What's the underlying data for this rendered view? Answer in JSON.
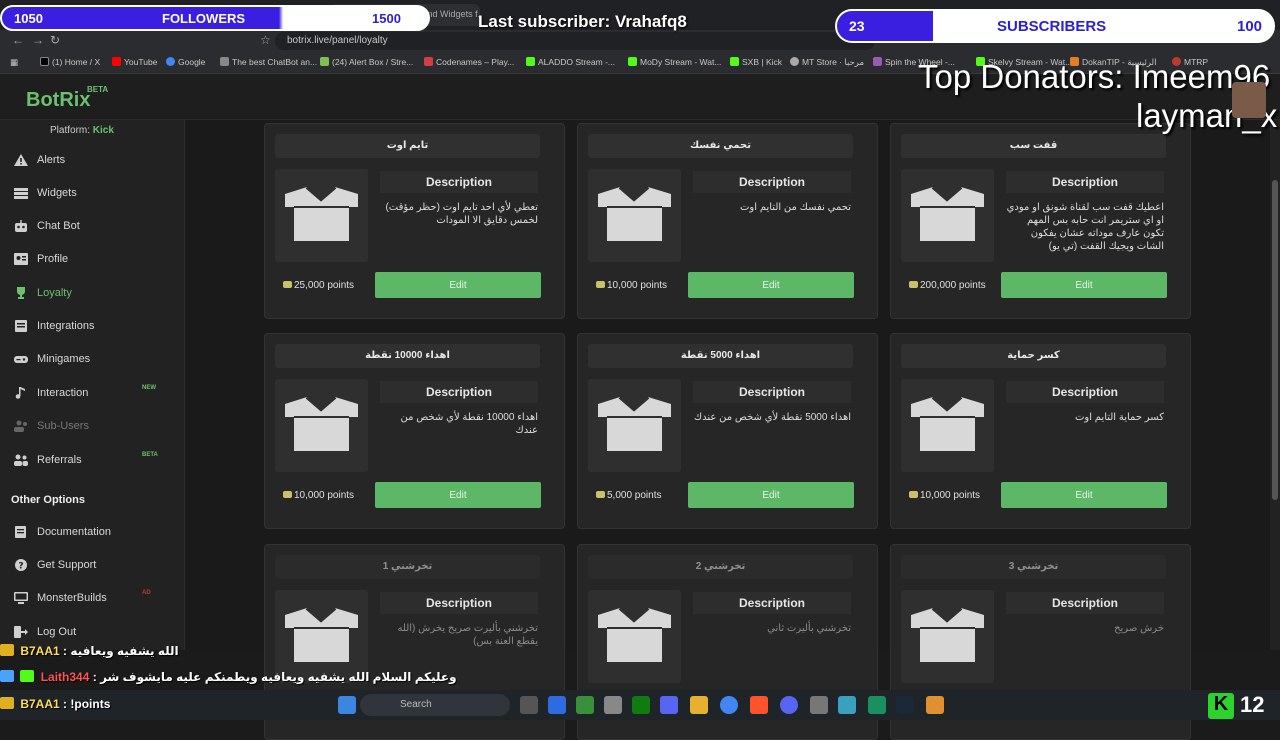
{
  "browser": {
    "active_tab": "The best ChatBot and Widgets f...",
    "url": "botrix.live/panel/loyalty",
    "bookmarks": [
      "(1) Home / X",
      "YouTube",
      "Google",
      "The best ChatBot an...",
      "(24) Alert Box / Stre...",
      "Codenames – Play...",
      "ALADDO Stream -...",
      "MoDy Stream - Wat...",
      "SXB | Kick",
      "MT Store · مرحبا",
      "Spin the Wheel -...",
      "Skelvy Stream - Wat...",
      "DokanTIP - الرئيسية",
      "MTRP"
    ]
  },
  "app": {
    "logo": "BotRix",
    "logo_badge": "BETA",
    "platform_label": "Platform:",
    "platform_value": "Kick"
  },
  "sidebar": {
    "items": [
      {
        "label": "Alerts",
        "icon": "warning-icon"
      },
      {
        "label": "Widgets",
        "icon": "widgets-icon"
      },
      {
        "label": "Chat Bot",
        "icon": "robot-icon"
      },
      {
        "label": "Profile",
        "icon": "profile-icon"
      },
      {
        "label": "Loyalty",
        "icon": "trophy-icon",
        "active": true
      },
      {
        "label": "Integrations",
        "icon": "integrations-icon"
      },
      {
        "label": "Minigames",
        "icon": "gamepad-icon"
      },
      {
        "label": "Interaction",
        "icon": "music-icon",
        "badge": "NEW"
      },
      {
        "label": "Sub-Users",
        "icon": "users-icon",
        "disabled": true
      },
      {
        "label": "Referrals",
        "icon": "referrals-icon",
        "badge": "BETA"
      }
    ],
    "other_options_title": "Other Options",
    "other_items": [
      {
        "label": "Documentation",
        "icon": "book-icon"
      },
      {
        "label": "Get Support",
        "icon": "help-icon"
      },
      {
        "label": "MonsterBuilds",
        "icon": "monitor-icon",
        "badge": "AD"
      },
      {
        "label": "Log Out",
        "icon": "logout-icon"
      }
    ]
  },
  "rewards": [
    {
      "title": "تايم اوت",
      "desc_header": "Description",
      "description": "تعطي لأي احد تايم اوت (حظر مؤقت) لخمس دقايق الا المودات",
      "points": "25,000 points",
      "edit_label": "Edit"
    },
    {
      "title": "تحمي نفسك",
      "desc_header": "Description",
      "description": "تحمي نفسك من التايم اوت",
      "points": "10,000 points",
      "edit_label": "Edit"
    },
    {
      "title": "قفت سب",
      "desc_header": "Description",
      "description": "اعطيك قفت سب لقناة شونق او مودي او اي ستريمر انت حابه بس المهم تكون عارف موداته عشان يفكون الشات ويجيك القفت (تي يو)",
      "points": "200,000 points",
      "edit_label": "Edit"
    },
    {
      "title": "اهداء 10000 نقطة",
      "desc_header": "Description",
      "description": "اهداء 10000 نقطة لأي شخص من عندك",
      "points": "10,000 points",
      "edit_label": "Edit"
    },
    {
      "title": "اهداء 5000 نقطة",
      "desc_header": "Description",
      "description": "اهداء 5000 نقطة لأي شخص من عندك",
      "points": "5,000 points",
      "edit_label": "Edit"
    },
    {
      "title": "كسر حماية",
      "desc_header": "Description",
      "description": "كسر حماية التايم اوت",
      "points": "10,000 points",
      "edit_label": "Edit"
    },
    {
      "title": "تخرشني 1",
      "desc_header": "Description",
      "description": "تخرشني بأليرت صريح يخرش (الله يقطع العنة بس)",
      "points": "",
      "edit_label": ""
    },
    {
      "title": "تخرشني 2",
      "desc_header": "Description",
      "description": "تخرشني بأليرت ثاني",
      "points": "",
      "edit_label": ""
    },
    {
      "title": "تخرشني 3",
      "desc_header": "Description",
      "description": "خرش صريح",
      "points": "",
      "edit_label": ""
    }
  ],
  "overlay": {
    "followers_count": "1050",
    "followers_label": "FOLLOWERS",
    "followers_goal": "1500",
    "last_subscriber": "Last subscriber: Vrahafq8",
    "subscribers_count": "23",
    "subscribers_label": "SUBSCRIBERS",
    "subscribers_goal": "100",
    "top_donators": "Top Donators: Imeem96",
    "top_donator_2": "layman_x"
  },
  "chat": [
    {
      "user": "B7AA1",
      "message": ": الله يشفيه ويعافيه"
    },
    {
      "user": "Laith344",
      "message": ": وعليكم السلام الله يشفيه ويعافيه ويطمنكم عليه مايشوف شر"
    },
    {
      "user": "B7AA1",
      "message": ": !points"
    }
  ],
  "taskbar": {
    "search_placeholder": "Search",
    "viewer_count": "12"
  },
  "colors": {
    "accent": "#5cb866",
    "overlay_blue": "#3b1fe0",
    "background": "#1a1a1a"
  }
}
